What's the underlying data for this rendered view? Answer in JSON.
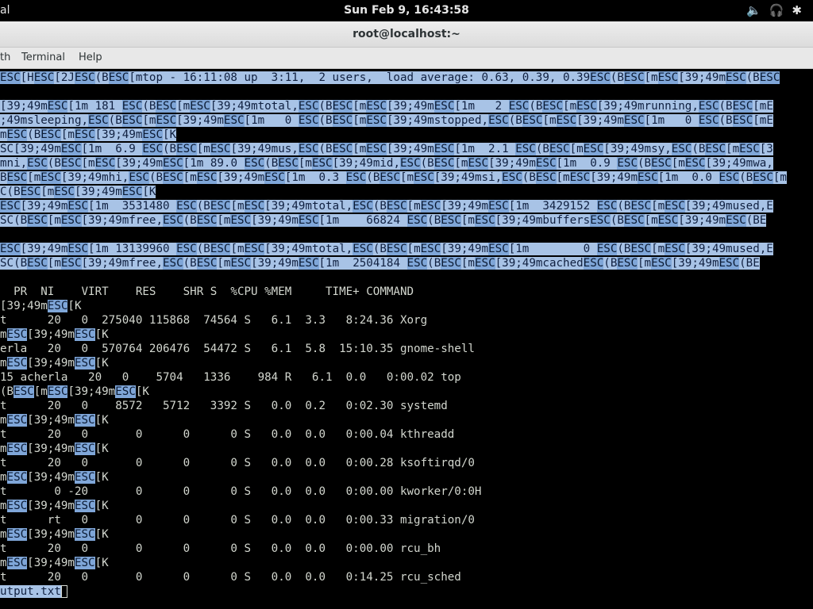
{
  "topbar": {
    "app_label": "al",
    "clock": "Sun Feb  9, 16:43:58",
    "tray_icons": [
      "volume-icon",
      "headphones-icon",
      "bluetooth-icon"
    ]
  },
  "window": {
    "title": "root@localhost:~"
  },
  "menu": [
    "th",
    "Terminal",
    "Help"
  ],
  "terminal": {
    "lines": [
      {
        "text": "ESC[HESC[2JESC(BESC[mtop - 16:11:08 up  3:11,  2 users,  load average: 0.63, 0.39, 0.39ESC(BESC[mESC[39;49mESC(BESC",
        "style": "hl"
      },
      {
        "text": "",
        "style": "plain"
      },
      {
        "text": "[39;49mESC[1m 181 ESC(BESC[mESC[39;49mtotal,ESC(BESC[mESC[39;49mESC[1m   2 ESC(BESC[mESC[39;49mrunning,ESC(BESC[mE",
        "style": "hl"
      },
      {
        "text": ";49msleeping,ESC(BESC[mESC[39;49mESC[1m   0 ESC(BESC[mESC[39;49mstopped,ESC(BESC[mESC[39;49mESC[1m   0 ESC(BESC[mE",
        "style": "hl"
      },
      {
        "text": "mESC(BESC[mESC[39;49mESC[K",
        "style": "hl"
      },
      {
        "text": "SC[39;49mESC[1m  6.9 ESC(BESC[mESC[39;49mus,ESC(BESC[mESC[39;49mESC[1m  2.1 ESC(BESC[mESC[39;49msy,ESC(BESC[mESC[3",
        "style": "hl"
      },
      {
        "text": "mni,ESC(BESC[mESC[39;49mESC[1m 89.0 ESC(BESC[mESC[39;49mid,ESC(BESC[mESC[39;49mESC[1m  0.9 ESC(BESC[mESC[39;49mwa,",
        "style": "hl"
      },
      {
        "text": "BESC[mESC[39;49mhi,ESC(BESC[mESC[39;49mESC[1m  0.3 ESC(BESC[mESC[39;49msi,ESC(BESC[mESC[39;49mESC[1m  0.0 ESC(BESC[m",
        "style": "hl"
      },
      {
        "text": "C(BESC[mESC[39;49mESC[K",
        "style": "hl"
      },
      {
        "text": "ESC[39;49mESC[1m  3531480 ESC(BESC[mESC[39;49mtotal,ESC(BESC[mESC[39;49mESC[1m  3429152 ESC(BESC[mESC[39;49mused,E",
        "style": "hl"
      },
      {
        "text": "SC(BESC[mESC[39;49mfree,ESC(BESC[mESC[39;49mESC[1m    66824 ESC(BESC[mESC[39;49mbuffersESC(BESC[mESC[39;49mESC(BE",
        "style": "hl"
      },
      {
        "text": "",
        "style": "plain"
      },
      {
        "text": "ESC[39;49mESC[1m 13139960 ESC(BESC[mESC[39;49mtotal,ESC(BESC[mESC[39;49mESC[1m        0 ESC(BESC[mESC[39;49mused,E",
        "style": "hl"
      },
      {
        "text": "SC(BESC[mESC[39;49mfree,ESC(BESC[mESC[39;49mESC[1m  2504184 ESC(BESC[mESC[39;49mcachedESC(BESC[mESC[39;49mESC(BE",
        "style": "hl"
      },
      {
        "text": "",
        "style": "plain"
      },
      {
        "text": "  PR  NI    VIRT    RES    SHR S  %CPU %MEM     TIME+ COMMAND",
        "style": "plain"
      },
      {
        "text": "[39;49mESC[K",
        "style": "plain"
      },
      {
        "text": "t      20   0  275040 115868  74564 S   6.1  3.3   8:24.36 Xorg",
        "style": "plain"
      },
      {
        "text": "mESC[39;49mESC[K",
        "style": "plain"
      },
      {
        "text": "erla   20   0  570764 206476  54472 S   6.1  5.8  15:10.35 gnome-shell",
        "style": "plain"
      },
      {
        "text": "mESC[39;49mESC[K",
        "style": "plain"
      },
      {
        "text": "15 acherla   20   0    5704   1336    984 R   6.1  0.0   0:00.02 top",
        "style": "plain"
      },
      {
        "text": "(BESC[mESC[39;49mESC[K",
        "style": "plain"
      },
      {
        "text": "t      20   0    8572   5712   3392 S   0.0  0.2   0:02.30 systemd",
        "style": "plain"
      },
      {
        "text": "mESC[39;49mESC[K",
        "style": "plain"
      },
      {
        "text": "t      20   0       0      0      0 S   0.0  0.0   0:00.04 kthreadd",
        "style": "plain"
      },
      {
        "text": "mESC[39;49mESC[K",
        "style": "plain"
      },
      {
        "text": "t      20   0       0      0      0 S   0.0  0.0   0:00.28 ksoftirqd/0",
        "style": "plain"
      },
      {
        "text": "mESC[39;49mESC[K",
        "style": "plain"
      },
      {
        "text": "t       0 -20       0      0      0 S   0.0  0.0   0:00.00 kworker/0:0H",
        "style": "plain"
      },
      {
        "text": "mESC[39;49mESC[K",
        "style": "plain"
      },
      {
        "text": "t      rt   0       0      0      0 S   0.0  0.0   0:00.33 migration/0",
        "style": "plain"
      },
      {
        "text": "mESC[39;49mESC[K",
        "style": "plain"
      },
      {
        "text": "t      20   0       0      0      0 S   0.0  0.0   0:00.00 rcu_bh",
        "style": "plain"
      },
      {
        "text": "mESC[39;49mESC[K",
        "style": "plain"
      },
      {
        "text": "t      20   0       0      0      0 S   0.0  0.0   0:14.25 rcu_sched",
        "style": "plain"
      },
      {
        "text": "utput.txt",
        "style": "hl"
      }
    ]
  }
}
